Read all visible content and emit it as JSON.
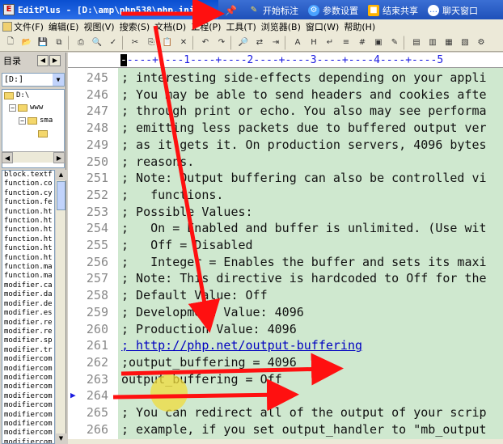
{
  "window": {
    "title": "EditPlus - [D:\\amp\\php538\\php.ini]",
    "app_icon_glyph": "E"
  },
  "sharebar": {
    "mark": "开始标注",
    "settings": "参数设置",
    "stop": "结束共享",
    "chat": "聊天窗口"
  },
  "menu": {
    "file": "文件(F)",
    "edit": "编辑(E)",
    "view": "视图(V)",
    "search": "搜索(S)",
    "document": "文档(D)",
    "project": "工程(P)",
    "tools": "工具(T)",
    "browser": "浏览器(B)",
    "window": "窗口(W)",
    "help": "帮助(H)"
  },
  "leftpanel": {
    "tab_label": "目录",
    "drive": "[D:]",
    "tree": [
      "D:\\",
      "www",
      "sma",
      ""
    ],
    "files": [
      "block.textf",
      "function.co",
      "function.cy",
      "function.fe",
      "function.ht",
      "function.ht",
      "function.ht",
      "function.ht",
      "function.ht",
      "function.ht",
      "function.ma",
      "function.ma",
      "modifier.ca",
      "modifier.da",
      "modifier.de",
      "modifier.es",
      "modifier.re",
      "modifier.re",
      "modifier.sp",
      "modifier.tr",
      "modifiercom",
      "modifiercom",
      "modifiercom",
      "modifiercom",
      "modifiercom",
      "modifiercom",
      "modifiercom",
      "modifiercom",
      "modifiercom",
      "modifiercom"
    ]
  },
  "ruler": "----+----1----+----2----+----3----+----4----+----5",
  "editor": {
    "lines": [
      {
        "num": "245",
        "text": "; interesting side-effects depending on your appli",
        "kind": "comment"
      },
      {
        "num": "246",
        "text": "; You may be able to send headers and cookies afte",
        "kind": "comment"
      },
      {
        "num": "247",
        "text": "; through print or echo. You also may see performa",
        "kind": "comment"
      },
      {
        "num": "248",
        "text": "; emitting less packets due to buffered output ver",
        "kind": "comment"
      },
      {
        "num": "249",
        "text": "; as it gets it. On production servers, 4096 bytes",
        "kind": "comment"
      },
      {
        "num": "250",
        "text": "; reasons.",
        "kind": "comment"
      },
      {
        "num": "251",
        "text": "; Note: Output buffering can also be controlled vi",
        "kind": "comment"
      },
      {
        "num": "252",
        "text": ";   functions.",
        "kind": "comment"
      },
      {
        "num": "253",
        "text": "; Possible Values:",
        "kind": "comment"
      },
      {
        "num": "254",
        "text": ";   On = Enabled and buffer is unlimited. (Use wit",
        "kind": "comment"
      },
      {
        "num": "255",
        "text": ";   Off = Disabled",
        "kind": "comment"
      },
      {
        "num": "256",
        "text": ";   Integer = Enables the buffer and sets its maxi",
        "kind": "comment"
      },
      {
        "num": "257",
        "text": "; Note: This directive is hardcoded to Off for the",
        "kind": "comment"
      },
      {
        "num": "258",
        "text": "; Default Value: Off",
        "kind": "comment"
      },
      {
        "num": "259",
        "text": "; Development Value: 4096",
        "kind": "comment"
      },
      {
        "num": "260",
        "text": "; Production Value: 4096",
        "kind": "comment"
      },
      {
        "num": "261",
        "text": "; http://php.net/output-buffering",
        "kind": "link"
      },
      {
        "num": "262",
        "text": ";output_buffering = 4096",
        "kind": "comment"
      },
      {
        "num": "263",
        "text": "output_buffering = Off",
        "kind": "code"
      },
      {
        "num": "264",
        "text": "",
        "kind": "code"
      },
      {
        "num": "265",
        "text": "; You can redirect all of the output of your scrip",
        "kind": "comment"
      },
      {
        "num": "266",
        "text": "; example, if you set output_handler to \"mb_output",
        "kind": "comment"
      }
    ]
  },
  "colors": {
    "code_background": "#cfe8cf",
    "annotation_red": "#ff1010",
    "titlebar_blue": "#0a4fd0"
  }
}
